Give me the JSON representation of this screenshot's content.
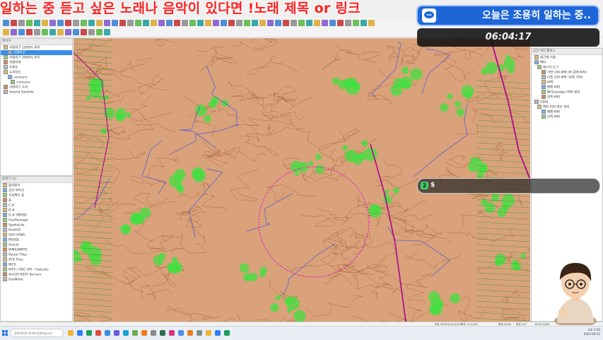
{
  "overlay": {
    "title": "일하는 중 듣고 싶은 노래나 음악이 있다면 !노래 제목 or 링크",
    "status_text": "오늘은 조용히 일하는 중..",
    "clock": "06:04:17",
    "chat_icon": "2",
    "chat_text": "$"
  },
  "layers_panel": {
    "title": "레이어",
    "items": [
      {
        "label": "사업지구 1000% 위치"
      },
      {
        "label": "사업지구"
      },
      {
        "label": "사업지구 3000% 위치"
      },
      {
        "label": "지형지적"
      },
      {
        "label": "주제도"
      },
      {
        "label": "수치지도"
      },
      {
        "label": "contours"
      },
      {
        "label": "contours"
      },
      {
        "label": "사업지구 수치"
      },
      {
        "label": "Vworld Satellite"
      }
    ]
  },
  "browser_panel": {
    "title": "탐색기 (2)",
    "items": [
      {
        "label": "즐겨찾기"
      },
      {
        "label": "공간 북마크"
      },
      {
        "label": "프로젝트 홈"
      },
      {
        "label": "홈"
      },
      {
        "label": "C:#"
      },
      {
        "label": "D:#"
      },
      {
        "label": "G:# (제작용)"
      },
      {
        "label": "GeoPackage"
      },
      {
        "label": "SpatiaLite"
      },
      {
        "label": "PostGIS"
      },
      {
        "label": "SAP HANA"
      },
      {
        "label": "MSSQL"
      },
      {
        "label": "Oracle"
      },
      {
        "label": "WMS/WMTS"
      },
      {
        "label": "Vector Tiles"
      },
      {
        "label": "XYZ Tiles"
      },
      {
        "label": "WCS"
      },
      {
        "label": "WFS / OGC API - Features"
      },
      {
        "label": "ArcGIS REST Servers"
      },
      {
        "label": "GeoNode"
      }
    ]
  },
  "processing_panel": {
    "title": "공간 처리 툴박스",
    "items": [
      {
        "label": "최근에 사용"
      },
      {
        "label": "벡터"
      },
      {
        "label": "래스터 도구"
      },
      {
        "label": "가변 너비 버퍼 (M 값에 따라)"
      },
      {
        "label": "다중 고리 버퍼 (일정 거리)"
      },
      {
        "label": "버퍼"
      },
      {
        "label": "평행 버퍼"
      },
      {
        "label": "쐐기(wedge) 버퍼 생성"
      },
      {
        "label": "한쪽 버퍼"
      },
      {
        "label": "GDAL"
      },
      {
        "label": "벡터 지리 정보 처리"
      },
      {
        "label": "평행 버퍼"
      },
      {
        "label": "한쪽 버퍼"
      }
    ]
  },
  "statusbar": {
    "coordinate": "좌표 183416.6,421811",
    "scale": "축척 1:13,929",
    "magnifier": "확대 100%",
    "rotation": "회전 0.0°",
    "crs": "EPSG:5186"
  },
  "taskbar": {
    "search_placeholder": "검색하려면 여기에 입력하십시오",
    "time": "오후 2:20",
    "date": "2023-09-21"
  },
  "colors": {
    "terrain": "#d9a27a",
    "contour": "#8a3b12",
    "vegetation": "#40e040",
    "road": "#b0148a",
    "water": "#3d4fe8",
    "circle": "#e020c0",
    "overlay_red": "#ff1f1f",
    "pill_blue": "#1e66d8"
  }
}
